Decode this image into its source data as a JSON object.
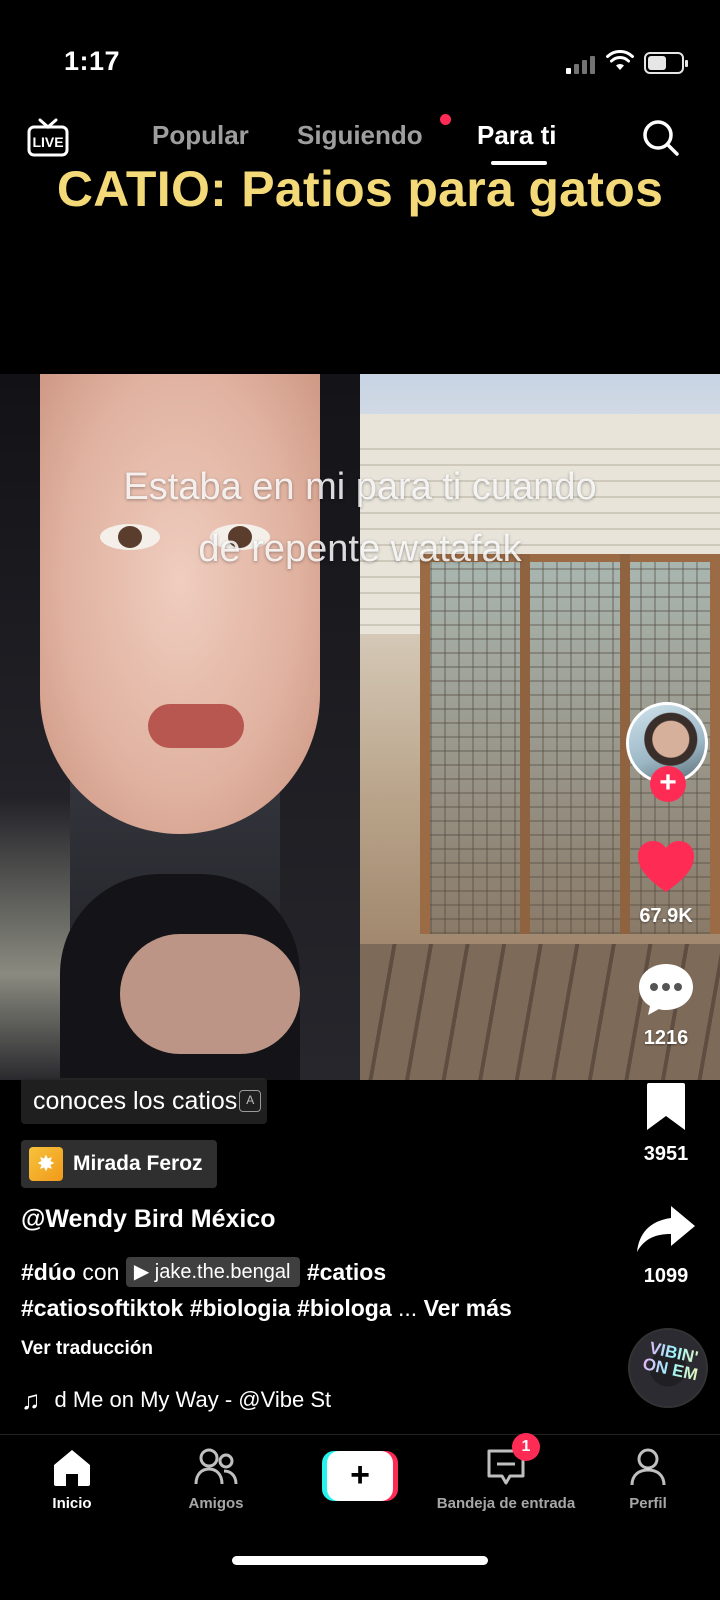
{
  "status_bar": {
    "time": "1:17"
  },
  "top_nav": {
    "live_label": "LIVE",
    "tabs": [
      {
        "label": "Popular",
        "active": false
      },
      {
        "label": "Siguiendo",
        "active": false,
        "notification_dot": true
      },
      {
        "label": "Para ti",
        "active": true
      }
    ]
  },
  "video": {
    "title": "CATIO: Patios para gatos",
    "caption_lines": [
      "Estaba en mi para ti cuando",
      "de repente watafak"
    ]
  },
  "actions": {
    "likes": "67.9K",
    "comments": "1216",
    "bookmarks": "3951",
    "shares": "1099",
    "follow_symbol": "+",
    "disc_text": "VIBIN' ON EM"
  },
  "description": {
    "caption_chip": "conoces los catios",
    "translate_chip_icon": "A",
    "effect_name": "Mirada Feroz",
    "author": "@Wendy Bird México",
    "duet_prefix": "#dúo",
    "duet_con": "con",
    "duet_user": "jake.the.bengal",
    "hashtag_catios": "#catios",
    "line2": "#catiosoftiktok #biologia #biologa",
    "ellipsis": "...",
    "see_more": "Ver más",
    "translate_link": "Ver traducción",
    "music": "d Me on My Way - @Vibe St"
  },
  "bottom_nav": {
    "home": "Inicio",
    "friends": "Amigos",
    "create_symbol": "+",
    "inbox": "Bandeja de entrada",
    "inbox_badge": "1",
    "profile": "Perfil"
  },
  "colors": {
    "title_yellow": "#f3d977",
    "accent_red": "#fe2c55",
    "accent_cyan": "#25f4ee"
  }
}
